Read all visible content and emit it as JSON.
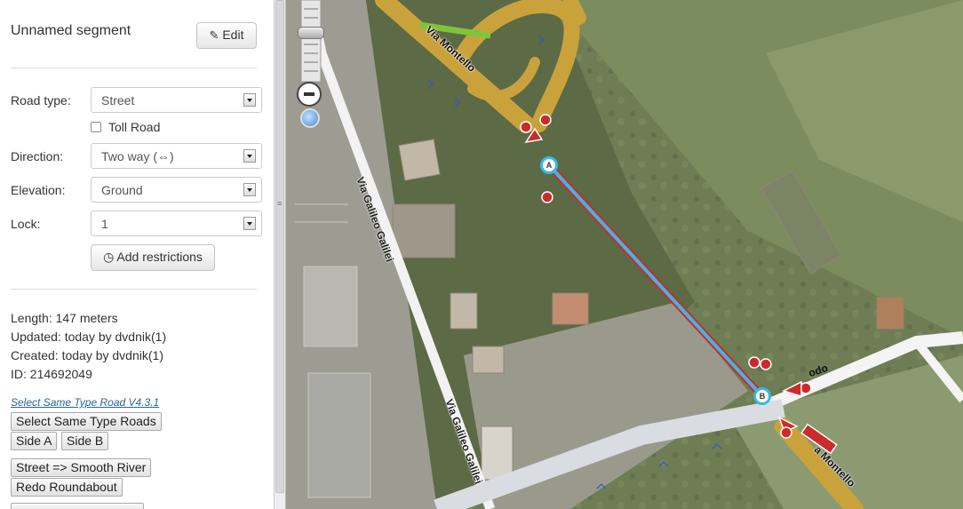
{
  "segment": {
    "title": "Unnamed segment",
    "edit_label": "Edit"
  },
  "form": {
    "road_type_label": "Road type:",
    "road_type_value": "Street",
    "toll_road_label": "Toll Road",
    "toll_road_checked": false,
    "direction_label": "Direction:",
    "direction_value": "Two way (⇔)",
    "elevation_label": "Elevation:",
    "elevation_value": "Ground",
    "lock_label": "Lock:",
    "lock_value": "1",
    "add_restrictions_label": "Add restrictions"
  },
  "info": {
    "length": "Length: 147 meters",
    "updated": "Updated: today by dvdnik(1)",
    "created": "Created: today by dvdnik(1)",
    "id": "ID: 214692049"
  },
  "script": {
    "link_label": "Select Same Type Road V4.3.1",
    "select_same_label": "Select Same Type Roads",
    "side_a_label": "Side A",
    "side_b_label": "Side B",
    "street_smooth_label": "Street => Smooth River",
    "redo_roundabout_label": "Redo Roundabout"
  },
  "map": {
    "road_labels": {
      "via_montello_top": "Via Montello",
      "via_galileo_1": "Via Galileo Galilei",
      "via_galileo_2": "Via Galileo Galilei",
      "modo": "odo",
      "montello_bottom": "a Montello"
    },
    "node_a": "A",
    "node_b": "B",
    "colors": {
      "highway": "#c9a23c",
      "selected": "#3fb6e3",
      "restriction": "#cc2b2b",
      "node_ring": "#35b8e8"
    }
  }
}
